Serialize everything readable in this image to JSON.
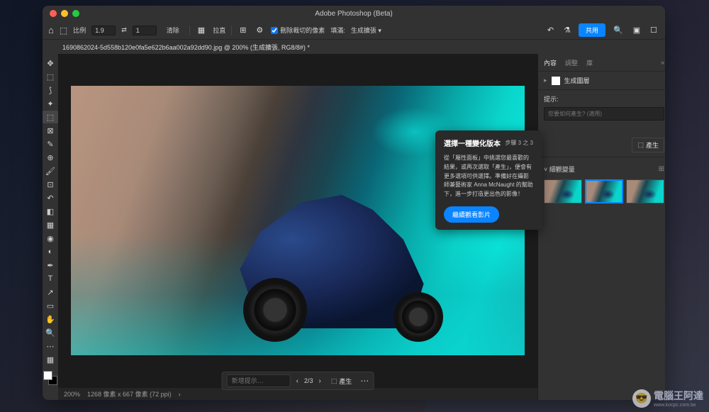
{
  "titlebar": {
    "title": "Adobe Photoshop (Beta)"
  },
  "menubar": {
    "ratio_label": "比例",
    "ratio_value": "1.9",
    "swap": "⇄",
    "ratio_value2": "1",
    "clear": "清除",
    "straighten": "拉直",
    "delete_cropped": "刪除裁切的像素",
    "fill_label": "填滿:",
    "fill_value": "生成擴張",
    "share": "共用"
  },
  "tab": {
    "filename": "1690862024-5d558b120e0fa5e622b6aa002a92dd90.jpg @ 200% (生成擴張, RG8/8#) *"
  },
  "genbar": {
    "placeholder": "新增提示…",
    "count": "2/3",
    "generate": "產生"
  },
  "statusbar": {
    "zoom": "200%",
    "dims": "1268 像素 x 667 像素 (72 ppi)"
  },
  "popup": {
    "title": "選擇一種變化版本",
    "step": "步驟 3 之 3",
    "body": "從「屬性面板」中挑選您最喜歡的結果，或再次選取「產生」，便會有更多選項可供選擇。準備好在攝影師兼藝術家 Anna McNaught 的幫助下，進一步打造更出色的影像！",
    "button": "繼續觀看影片"
  },
  "rpanel": {
    "tabs": {
      "content": "內容",
      "adjust": "調整",
      "lib": "庫"
    },
    "layer_name": "生成圖層",
    "prompt_label": "提示:",
    "prompt_placeholder": "您要如何產生? (適用)",
    "generate": "產生",
    "variations": "細觀變量"
  },
  "watermark": {
    "main": "電腦王阿達",
    "sub": "www.kocpc.com.tw"
  }
}
